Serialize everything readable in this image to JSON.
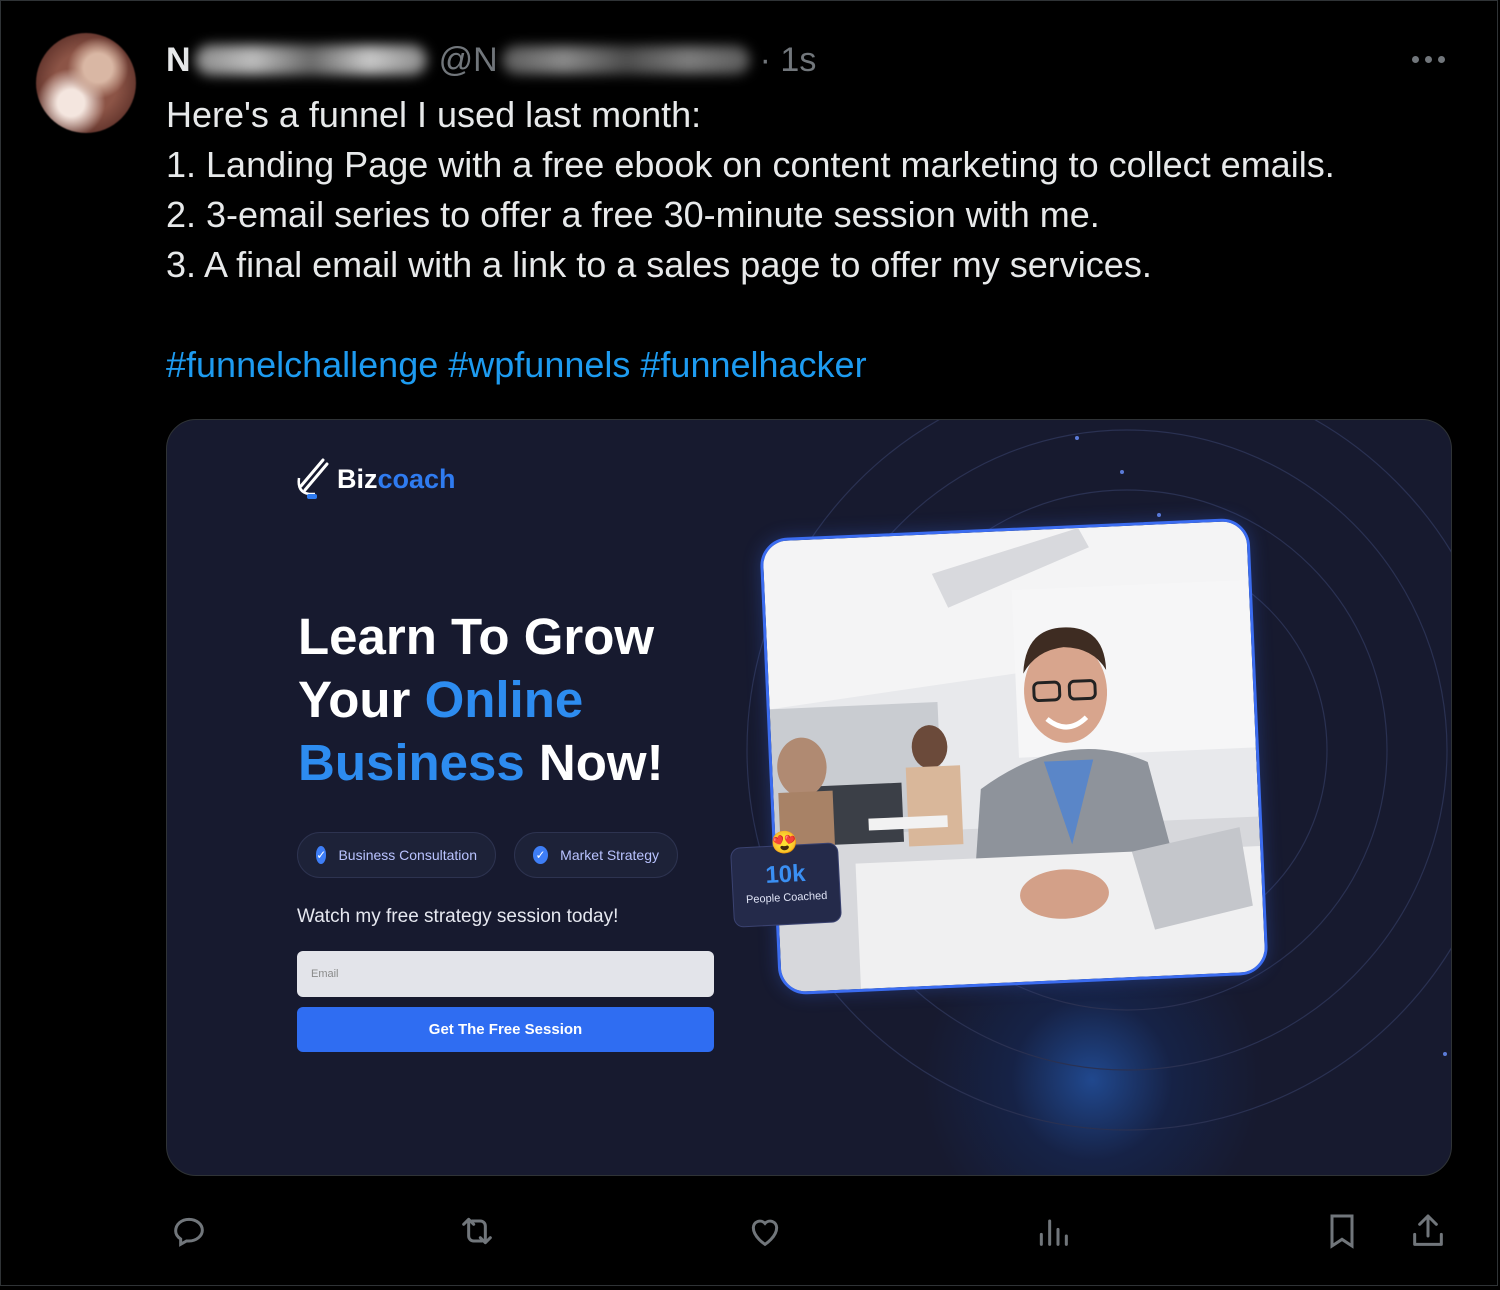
{
  "tweet": {
    "author_initial": "N",
    "handle_prefix": "@N",
    "time": "· 1s",
    "lines": [
      "Here's a funnel I used last month:",
      "1. Landing Page with a free ebook on content marketing to collect emails.",
      "2. 3-email series to offer a free 30-minute session with me.",
      "3. A final email with a link to a sales page to offer my services."
    ],
    "hashtags": [
      "#funnelchallenge",
      "#wpfunnels",
      "#funnelhacker"
    ]
  },
  "card": {
    "logo_a": "Biz",
    "logo_b": "coach",
    "headline": {
      "l1": "Learn To Grow",
      "l2a": "Your ",
      "l2b": "Online",
      "l3a": "Business",
      "l3b": " Now!"
    },
    "pills": [
      "Business Consultation",
      "Market Strategy"
    ],
    "watch_text": "Watch my free strategy session today!",
    "email_placeholder": "Email",
    "cta_label": "Get The Free Session",
    "badge": {
      "emoji": "😍",
      "big": "10k",
      "small": "People Coached"
    }
  },
  "colors": {
    "accent": "#1d9bf0",
    "card_bg": "#171a2f",
    "brand_blue": "#2f6df2"
  },
  "icons": [
    "more-icon",
    "reply-icon",
    "retweet-icon",
    "like-icon",
    "views-icon",
    "bookmark-icon",
    "share-icon",
    "check-icon",
    "logo-icon"
  ]
}
